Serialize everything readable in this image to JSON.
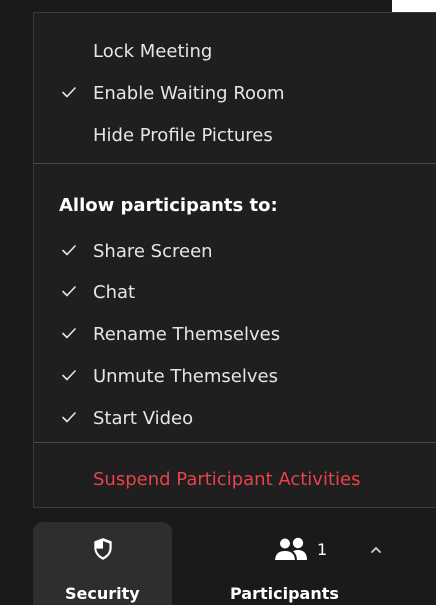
{
  "menu": {
    "top_items": [
      {
        "label": "Lock Meeting",
        "checked": false
      },
      {
        "label": "Enable Waiting Room",
        "checked": true
      },
      {
        "label": "Hide Profile Pictures",
        "checked": false
      }
    ],
    "section_header": "Allow participants to:",
    "participant_items": [
      {
        "label": "Share Screen",
        "checked": true
      },
      {
        "label": "Chat",
        "checked": true
      },
      {
        "label": "Rename Themselves",
        "checked": true
      },
      {
        "label": "Unmute Themselves",
        "checked": true
      },
      {
        "label": "Start Video",
        "checked": true
      }
    ],
    "suspend_label": "Suspend Participant Activities"
  },
  "toolbar": {
    "security_label": "Security",
    "participants_label": "Participants",
    "participants_count": "1"
  },
  "icons": {
    "check": "check-icon",
    "security": "shield-icon",
    "participants": "people-icon",
    "chevron": "chevron-up-icon"
  },
  "colors": {
    "menu_background": "#1f1f1f",
    "text": "#e6e6e6",
    "danger": "#e8424a",
    "security_button": "#2e2e2e"
  }
}
